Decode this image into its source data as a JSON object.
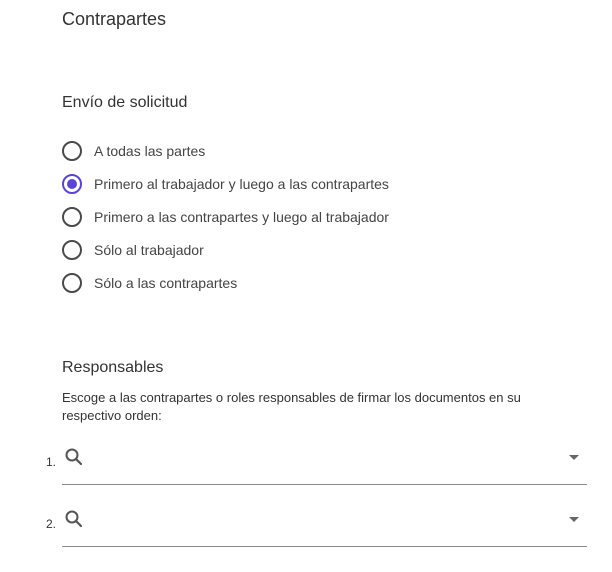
{
  "header": {
    "title": "Contrapartes"
  },
  "envio": {
    "title": "Envío de solicitud",
    "options": [
      {
        "label": "A todas las partes",
        "selected": false
      },
      {
        "label": "Primero al trabajador y luego a las contrapartes",
        "selected": true
      },
      {
        "label": "Primero a las contrapartes y luego al trabajador",
        "selected": false
      },
      {
        "label": "Sólo al trabajador",
        "selected": false
      },
      {
        "label": "Sólo a las contrapartes",
        "selected": false
      }
    ],
    "accent_color": "#5b45d8"
  },
  "responsables": {
    "title": "Responsables",
    "description": "Escoge a las contrapartes o roles responsables de firmar los documentos en su respectivo orden:",
    "fields": [
      {
        "number": "1.",
        "value": "",
        "icon": "search-icon"
      },
      {
        "number": "2.",
        "value": "",
        "icon": "search-icon"
      }
    ]
  }
}
